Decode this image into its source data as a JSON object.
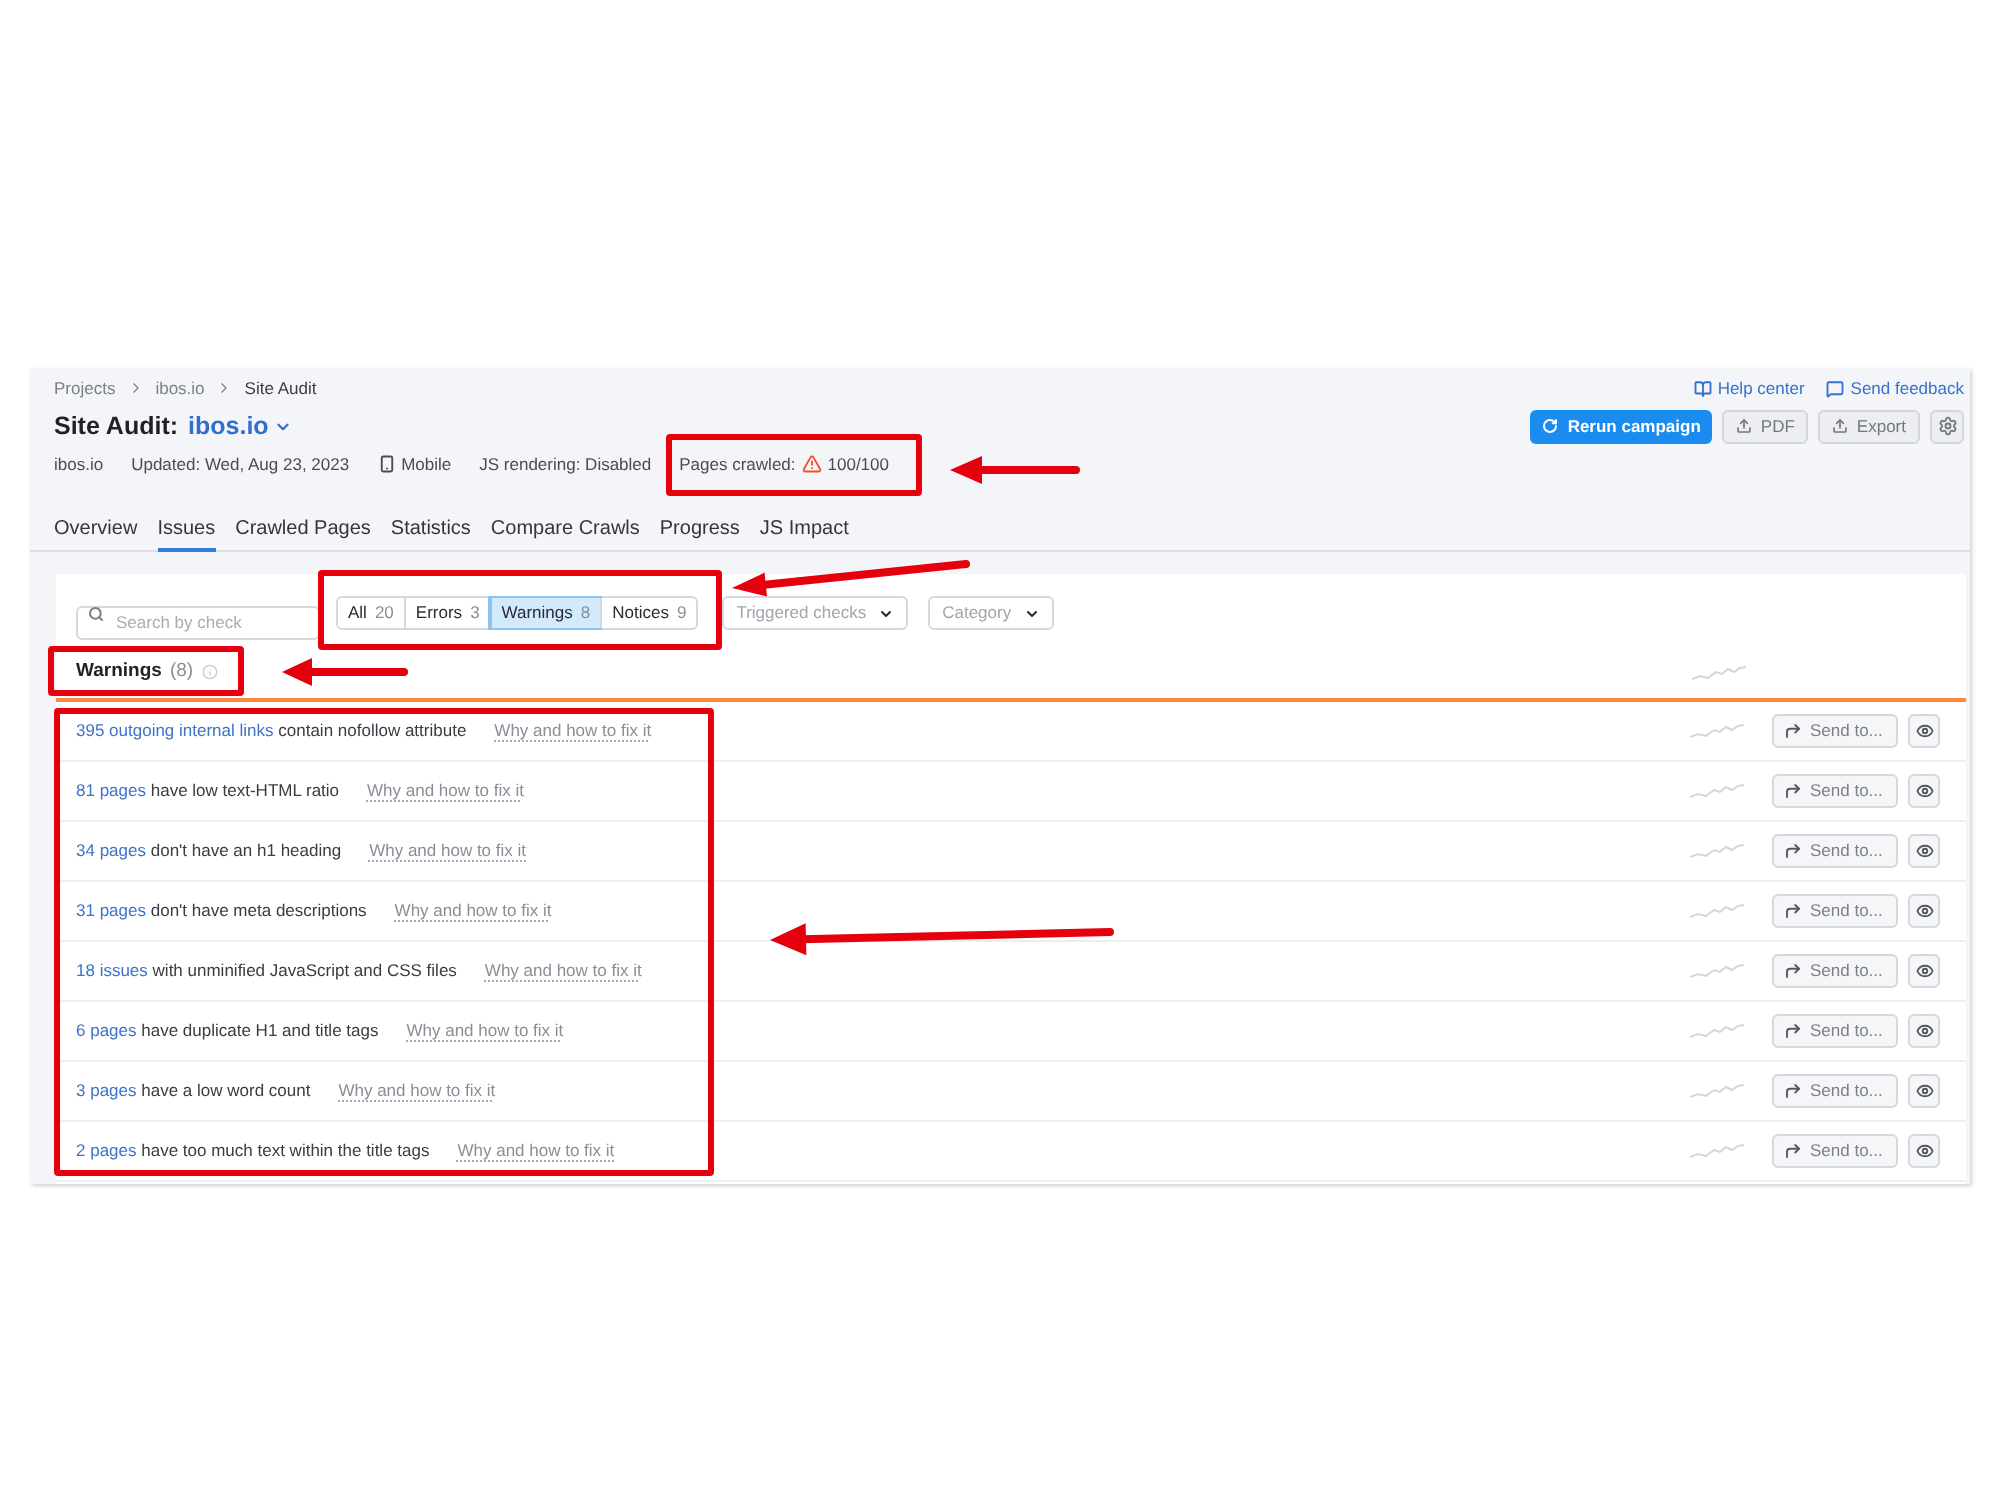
{
  "breadcrumbs": [
    {
      "label": "Projects"
    },
    {
      "label": "ibos.io"
    },
    {
      "label": "Site Audit"
    }
  ],
  "header_links": [
    {
      "label": "Help center",
      "kind": "help"
    },
    {
      "label": "Send feedback",
      "kind": "feedback"
    }
  ],
  "title": {
    "prefix": "Site Audit:",
    "project": "ibos.io"
  },
  "actions": [
    {
      "label": "Rerun campaign",
      "kind": "primary"
    },
    {
      "label": "PDF",
      "kind": "export"
    },
    {
      "label": "Export",
      "kind": "export"
    },
    {
      "kind": "settings"
    }
  ],
  "meta": {
    "domain": "ibos.io",
    "updated": "Updated: Wed, Aug 23, 2023",
    "device": "Mobile",
    "js_rendering": "JS rendering: Disabled",
    "pages_crawled_label": "Pages crawled:",
    "crawl_warning": true,
    "pages_crawled": "100/100"
  },
  "tabs": [
    {
      "label": "Overview",
      "selected": false
    },
    {
      "label": "Issues",
      "selected": true
    },
    {
      "label": "Crawled Pages",
      "selected": false
    },
    {
      "label": "Statistics",
      "selected": false
    },
    {
      "label": "Compare Crawls",
      "selected": false
    },
    {
      "label": "Progress",
      "selected": false
    },
    {
      "label": "JS Impact",
      "selected": false
    }
  ],
  "search": {
    "placeholder": "Search by check"
  },
  "filters": [
    {
      "label": "All",
      "count": "20",
      "selected": false
    },
    {
      "label": "Errors",
      "count": "3",
      "selected": false
    },
    {
      "label": "Warnings",
      "count": "8",
      "selected": true
    },
    {
      "label": "Notices",
      "count": "9",
      "selected": false
    }
  ],
  "dropdowns": [
    {
      "label": "Triggered checks"
    },
    {
      "label": "Category"
    }
  ],
  "section": {
    "title": "Warnings",
    "count": "(8)"
  },
  "issues": [
    {
      "link": "395 outgoing internal links",
      "text": "contain nofollow attribute",
      "help": "Why and how to fix it",
      "action": "Send to..."
    },
    {
      "link": "81 pages",
      "text": "have low text-HTML ratio",
      "help": "Why and how to fix it",
      "action": "Send to..."
    },
    {
      "link": "34 pages",
      "text": "don't have an h1 heading",
      "help": "Why and how to fix it",
      "action": "Send to..."
    },
    {
      "link": "31 pages",
      "text": "don't have meta descriptions",
      "help": "Why and how to fix it",
      "action": "Send to..."
    },
    {
      "link": "18 issues",
      "text": "with unminified JavaScript and CSS files",
      "help": "Why and how to fix it",
      "action": "Send to..."
    },
    {
      "link": "6 pages",
      "text": "have duplicate H1 and title tags",
      "help": "Why and how to fix it",
      "action": "Send to..."
    },
    {
      "link": "3 pages",
      "text": "have a low word count",
      "help": "Why and how to fix it",
      "action": "Send to..."
    },
    {
      "link": "2 pages",
      "text": "have too much text within the title tags",
      "help": "Why and how to fix it",
      "action": "Send to..."
    }
  ]
}
